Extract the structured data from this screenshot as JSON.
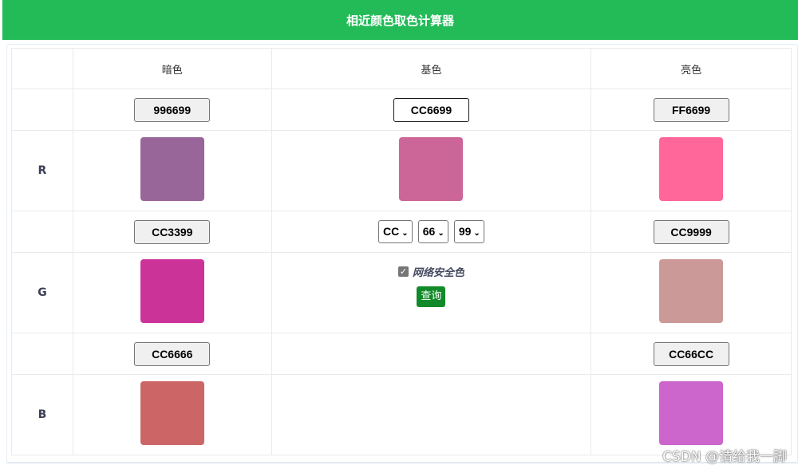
{
  "header": {
    "title": "相近颜色取色计算器"
  },
  "columns": {
    "dark": "暗色",
    "base": "基色",
    "light": "亮色"
  },
  "rows": [
    {
      "dark_hex": "996699",
      "base_hex": "CC6699",
      "light_hex": "FF6699",
      "channel": "R",
      "dark_color": "#996699",
      "base_color": "#CC6699",
      "light_color": "#FF6699"
    },
    {
      "dark_hex": "CC3399",
      "light_hex": "CC9999",
      "channel": "G",
      "dark_color": "#CC3399",
      "light_color": "#CC9999"
    },
    {
      "dark_hex": "CC6666",
      "light_hex": "CC66CC",
      "channel": "B",
      "dark_color": "#CC6666",
      "light_color": "#CC66CC"
    }
  ],
  "selects": {
    "r": "CC",
    "g": "66",
    "b": "99"
  },
  "web_safe": {
    "label": "网络安全色",
    "checked": true
  },
  "query_button": "查询",
  "watermark": "CSDN @请给我一脚",
  "colors": {
    "header_bg": "#22bb58",
    "query_bg": "#128a2a"
  }
}
